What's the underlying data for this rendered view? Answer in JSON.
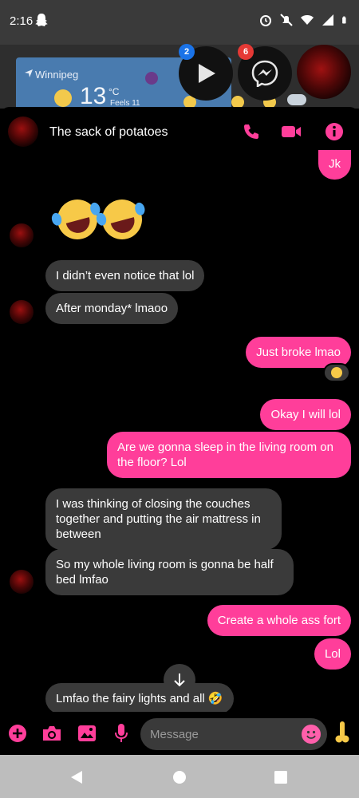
{
  "status_bar": {
    "time": "2:16",
    "icons": [
      "snapchat-icon",
      "alarm-icon",
      "mute-icon",
      "wifi-icon",
      "signal-icon",
      "battery-icon"
    ]
  },
  "weather_widget": {
    "city": "Winnipeg",
    "temperature": "13",
    "unit": "°C",
    "feels_like": "Feels 11"
  },
  "chat_heads": [
    {
      "name": "play-store-head",
      "badge": "2",
      "badge_color": "#1a73e8"
    },
    {
      "name": "messenger-head",
      "badge": "6",
      "badge_color": "#e53935"
    },
    {
      "name": "contact-head"
    }
  ],
  "header": {
    "title": "The sack of potatoes",
    "accent": "#ff3e9a"
  },
  "messages": [
    {
      "dir": "out",
      "text": "Jk"
    },
    {
      "dir": "in",
      "text": "I didn’t even notice that lol"
    },
    {
      "dir": "in",
      "text": "After monday* lmaoo"
    },
    {
      "dir": "out",
      "text": "Just broke lmao"
    },
    {
      "dir": "out",
      "text": "Okay I will lol"
    },
    {
      "dir": "out",
      "text": "Are we gonna sleep in the living room on\nthe floor? Lol"
    },
    {
      "dir": "in",
      "text": "I was thinking of closing the couches\ntogether and putting the air mattress in\nbetween"
    },
    {
      "dir": "in",
      "text": "So my whole living room is gonna be half\nbed lmfao"
    },
    {
      "dir": "out",
      "text": "Create a whole ass fort"
    },
    {
      "dir": "out",
      "text": "Lol"
    },
    {
      "dir": "in",
      "text": "Lmfao the fairy lights and all 🤣"
    }
  ],
  "composer": {
    "placeholder": "Message"
  },
  "colors": {
    "outgoing_bubble": "#ff3e9a",
    "incoming_bubble": "#3a3a3a",
    "background": "#000000"
  }
}
